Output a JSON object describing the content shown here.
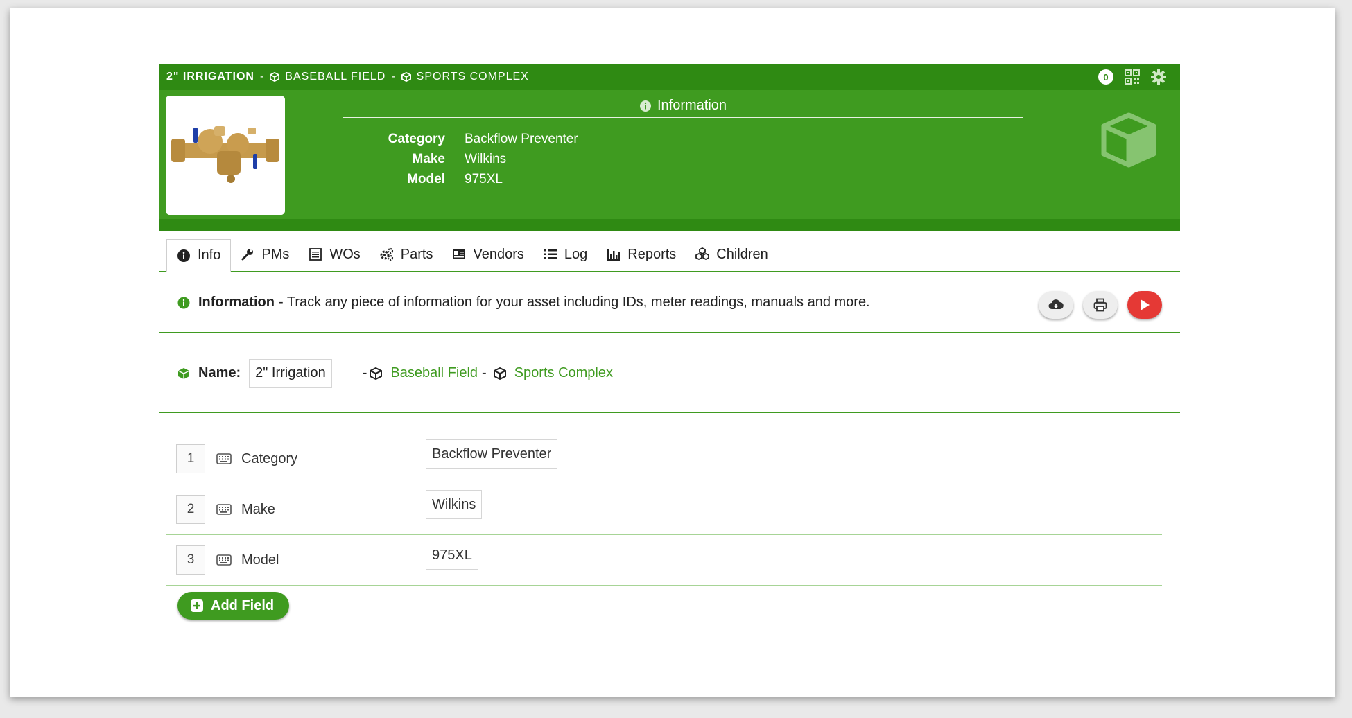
{
  "header": {
    "crumbs": {
      "asset": "2\" IRRIGATION",
      "parent": "BASEBALL FIELD",
      "root": "SPORTS COMPLEX",
      "separator": "-"
    },
    "count": "0",
    "info_title": "Information",
    "info_rows": [
      {
        "key": "Category",
        "value": "Backflow Preventer"
      },
      {
        "key": "Make",
        "value": "Wilkins"
      },
      {
        "key": "Model",
        "value": "975XL"
      }
    ]
  },
  "tabs": [
    {
      "label": "Info",
      "icon": "info-circle-icon"
    },
    {
      "label": "PMs",
      "icon": "wrench-icon"
    },
    {
      "label": "WOs",
      "icon": "work-order-icon"
    },
    {
      "label": "Parts",
      "icon": "gears-icon"
    },
    {
      "label": "Vendors",
      "icon": "address-card-icon"
    },
    {
      "label": "Log",
      "icon": "list-icon"
    },
    {
      "label": "Reports",
      "icon": "bar-chart-icon"
    },
    {
      "label": "Children",
      "icon": "cubes-icon"
    }
  ],
  "banner": {
    "title": "Information",
    "text": "- Track any piece of information for your asset including IDs, meter readings, manuals and more."
  },
  "name_row": {
    "label": "Name:",
    "value": "2\" Irrigation",
    "dash": "-",
    "parent": "Baseball Field",
    "root": "Sports Complex"
  },
  "fields": [
    {
      "index": "1",
      "name": "Category",
      "value": "Backflow Preventer"
    },
    {
      "index": "2",
      "name": "Make",
      "value": "Wilkins"
    },
    {
      "index": "3",
      "name": "Model",
      "value": "975XL"
    }
  ],
  "add_field_label": "Add Field",
  "colors": {
    "brand_green": "#3f9b20",
    "dark_green": "#2f8a13",
    "danger_red": "#e53935"
  }
}
